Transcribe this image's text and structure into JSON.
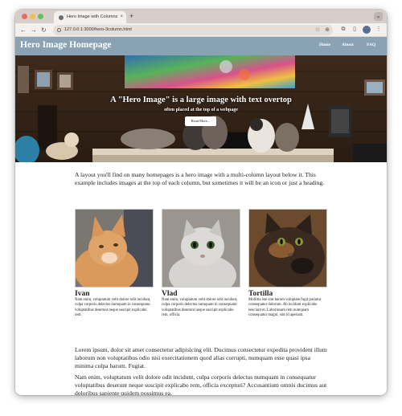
{
  "browser": {
    "tab_title": "Hero Image with Columns",
    "tab_close": "×",
    "new_tab": "+",
    "url": "127.0.0.1:3000/hero-3column.html",
    "icons": [
      "back-arrow-icon",
      "forward-arrow-icon",
      "reload-icon",
      "info-icon",
      "star-icon",
      "zoom-icon",
      "extensions-icon",
      "sidebar-icon",
      "profile-avatar",
      "menu-dots-icon"
    ]
  },
  "site": {
    "title": "Hero Image Homepage",
    "nav": [
      "Home",
      "About",
      "FAQ"
    ]
  },
  "hero": {
    "title": "A \"Hero Image\" is a large image with text overtop",
    "subtitle": "often placed at the top of a webpage",
    "button": "Read More..."
  },
  "intro": "A layout you'll find on many homepages is a hero image with a multi-column layout below it. This example includes images at the top of each column, but sometimes it will be an icon or just a heading.",
  "columns": [
    {
      "name": "Ivan",
      "text": "Nam enim, voluptatum velit dolore odit incidunt, culpa corporis delectus numquam in consequatur voluptatibus deserunt neque suscipit explicabo rem."
    },
    {
      "name": "Vlad",
      "text": "Nam enim, voluptatum velit dolore odit incidunt, culpa corporis delectus numquam in consequatur voluptatibus deserunt neque suscipit explicabo rem, officia."
    },
    {
      "name": "Tortilla",
      "text": "Mollitia iste sint harum voluptate fugit pariatur consequatur dolorum. Ab incidunt explicabo nesciunt et. Laboriosam rem numquam consequatur magni, sint id aperiam."
    }
  ],
  "paragraphs": [
    "Lorem ipsum, dolor sit amet consectetur adipisicing elit. Ducimus consectetur expedita provident illum laborum non voluptatibus odio nisi exercitationem quod alias corrupti, numquam esse quasi ipsa minima culpa harum. Fugiat.",
    "Nam enim, voluptatum velit dolore odit incidunt, culpa corporis delectus numquam in consequatur voluptatibus deserunt neque suscipit explicabo rem, officia excepturi? Accusantium omnis ducimus aut doloribus sapiente quidem possimus ea."
  ],
  "colors": {
    "nav_bg": "#8aa3b4",
    "tab_strip": "#d7cec9",
    "toolbar": "#f3f0ee"
  }
}
